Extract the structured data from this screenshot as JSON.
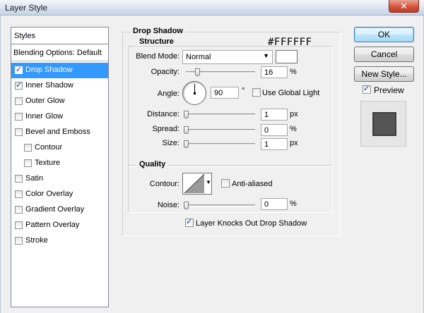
{
  "window": {
    "title": "Layer Style",
    "close_glyph": "✕"
  },
  "styles_panel": {
    "header": "Styles",
    "blending": "Blending Options: Default",
    "items": [
      {
        "label": "Drop Shadow",
        "checked": true,
        "selected": true,
        "indent": false
      },
      {
        "label": "Inner Shadow",
        "checked": true,
        "selected": false,
        "indent": false
      },
      {
        "label": "Outer Glow",
        "checked": false,
        "selected": false,
        "indent": false
      },
      {
        "label": "Inner Glow",
        "checked": false,
        "selected": false,
        "indent": false
      },
      {
        "label": "Bevel and Emboss",
        "checked": false,
        "selected": false,
        "indent": false
      },
      {
        "label": "Contour",
        "checked": false,
        "selected": false,
        "indent": true
      },
      {
        "label": "Texture",
        "checked": false,
        "selected": false,
        "indent": true
      },
      {
        "label": "Satin",
        "checked": false,
        "selected": false,
        "indent": false
      },
      {
        "label": "Color Overlay",
        "checked": false,
        "selected": false,
        "indent": false
      },
      {
        "label": "Gradient Overlay",
        "checked": false,
        "selected": false,
        "indent": false
      },
      {
        "label": "Pattern Overlay",
        "checked": false,
        "selected": false,
        "indent": false
      },
      {
        "label": "Stroke",
        "checked": false,
        "selected": false,
        "indent": false
      }
    ]
  },
  "drop_shadow": {
    "title": "Drop Shadow",
    "structure": {
      "title": "Structure",
      "color_annotation": "#FFFFFF",
      "blend_mode_label": "Blend Mode:",
      "blend_mode_value": "Normal",
      "blend_color": "#ffffff",
      "opacity_label": "Opacity:",
      "opacity_value": "16",
      "opacity_unit": "%",
      "opacity_level": 0.16,
      "angle_label": "Angle:",
      "angle_value": "90",
      "angle_unit": "°",
      "use_global_light_label": "Use Global Light",
      "use_global_light": false,
      "distance_label": "Distance:",
      "distance_value": "1",
      "distance_unit": "px",
      "distance_level": 0.0,
      "spread_label": "Spread:",
      "spread_value": "0",
      "spread_unit": "%",
      "spread_level": 0.0,
      "size_label": "Size:",
      "size_value": "1",
      "size_unit": "px",
      "size_level": 0.0
    },
    "quality": {
      "title": "Quality",
      "contour_label": "Contour:",
      "anti_aliased_label": "Anti-aliased",
      "anti_aliased": false,
      "noise_label": "Noise:",
      "noise_value": "0",
      "noise_unit": "%",
      "noise_level": 0.0
    },
    "knockout_label": "Layer Knocks Out Drop Shadow",
    "knockout": true
  },
  "buttons": {
    "ok": "OK",
    "cancel": "Cancel",
    "new_style": "New Style...",
    "preview_label": "Preview",
    "preview_checked": true,
    "preview_color": "#555555"
  }
}
